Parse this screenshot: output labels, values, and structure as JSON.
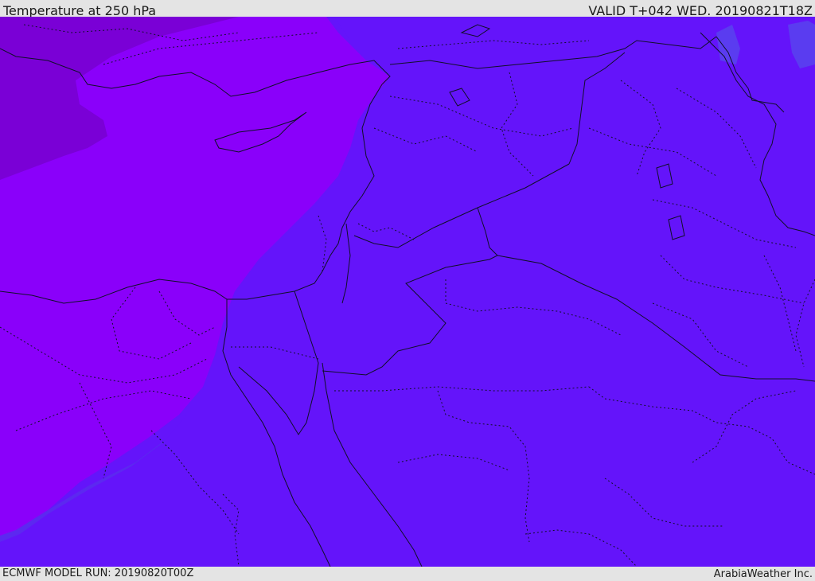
{
  "header": {
    "title": "Temperature at 250 hPa",
    "valid_time": "VALID T+042 WED. 20190821T18Z"
  },
  "footer": {
    "model_run": "ECMWF MODEL RUN: 20190820T00Z",
    "credit": "ArabiaWeather Inc."
  },
  "map": {
    "field": "temperature",
    "level": "250 hPa",
    "colors": {
      "coldest_zone": "#7a00d6",
      "cold_zone": "#8a00fa",
      "mid_zone": "#7210fc",
      "main_zone": "#6414fa",
      "mild_zone": "#5c28f0",
      "border_line": "#101028"
    }
  }
}
